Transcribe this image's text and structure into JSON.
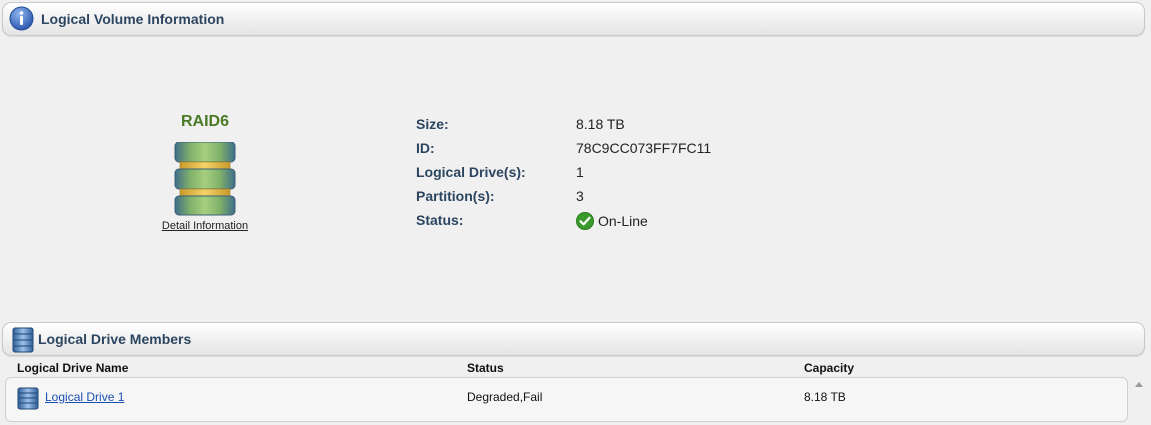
{
  "volume_section": {
    "title": "Logical Volume Information",
    "icon": "info-icon"
  },
  "raid": {
    "level": "RAID6",
    "detail_link": "Detail Information",
    "icon": "raid-stack-icon"
  },
  "properties": [
    {
      "label": "Size:",
      "value": "8.18 TB"
    },
    {
      "label": "ID:",
      "value": "78C9CC073FF7FC11"
    },
    {
      "label": "Logical Drive(s):",
      "value": "1"
    },
    {
      "label": "Partition(s):",
      "value": "3"
    },
    {
      "label": "Status:",
      "value": "On-Line",
      "icon": "check-circle-icon",
      "status_color": "#3b9a2c"
    }
  ],
  "members_section": {
    "title": "Logical Drive Members",
    "icon": "server-icon"
  },
  "members_table": {
    "columns": [
      "Logical Drive Name",
      "Status",
      "Capacity"
    ],
    "rows": [
      {
        "name": "Logical Drive 1",
        "status": "Degraded,Fail",
        "capacity": "8.18 TB",
        "icon": "drive-icon"
      }
    ]
  },
  "colors": {
    "header_text": "#2c4560",
    "raid_text": "#4a7a25",
    "link": "#1a4fb0"
  }
}
